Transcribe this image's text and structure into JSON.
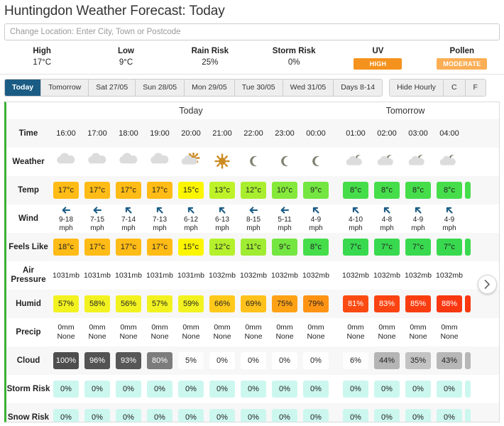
{
  "header": {
    "title": "Huntingdon Weather Forecast: Today",
    "location_placeholder": "Change Location: Enter City, Town or Postcode",
    "location_value": ""
  },
  "summary": [
    {
      "label": "High",
      "value": "17°C",
      "badge": null,
      "badge_color": null
    },
    {
      "label": "Low",
      "value": "9°C",
      "badge": null,
      "badge_color": null
    },
    {
      "label": "Rain Risk",
      "value": "25%",
      "badge": null,
      "badge_color": null
    },
    {
      "label": "Storm Risk",
      "value": "0%",
      "badge": null,
      "badge_color": null
    },
    {
      "label": "UV",
      "value": "",
      "badge": "HIGH",
      "badge_color": "#F5921E"
    },
    {
      "label": "Pollen",
      "value": "",
      "badge": "MODERATE",
      "badge_color": "#FBAE55"
    }
  ],
  "tabs": {
    "days": [
      {
        "label": "Today",
        "active": true
      },
      {
        "label": "Tomorrow",
        "active": false
      },
      {
        "label": "Sat 27/05",
        "active": false
      },
      {
        "label": "Sun 28/05",
        "active": false
      },
      {
        "label": "Mon 29/05",
        "active": false
      },
      {
        "label": "Tue 30/05",
        "active": false
      },
      {
        "label": "Wed 31/05",
        "active": false
      },
      {
        "label": "Days 8-14",
        "active": false
      }
    ],
    "options": [
      {
        "label": "Hide Hourly",
        "active": false
      },
      {
        "label": "C",
        "active": false
      },
      {
        "label": "F",
        "active": false
      }
    ],
    "active_color": "#1b5c85"
  },
  "grid": {
    "day_headings": {
      "today": "Today",
      "tomorrow": "Tomorrow"
    },
    "row_labels": {
      "time": "Time",
      "weather": "Weather",
      "temp": "Temp",
      "wind": "Wind",
      "feels_like": "Feels Like",
      "air_pressure": "Air Pressure",
      "humid": "Humid",
      "precip": "Precip",
      "cloud": "Cloud",
      "storm_risk": "Storm Risk",
      "snow_risk": "Snow Risk"
    },
    "next_button_icon": "chevron-right-icon",
    "today": {
      "times": [
        "16:00",
        "17:00",
        "18:00",
        "19:00",
        "20:00",
        "21:00",
        "22:00",
        "23:00",
        "00:00"
      ],
      "weather_icons": [
        "cloud",
        "cloud",
        "cloud",
        "cloud",
        "sun-cloud",
        "sun",
        "moon",
        "moon",
        "moon"
      ],
      "temp": [
        "17°c",
        "17°c",
        "17°c",
        "17°c",
        "15°c",
        "13°c",
        "12°c",
        "10°c",
        "9°c"
      ],
      "temp_colors": [
        "#FFBB16",
        "#FFBB16",
        "#FFBB16",
        "#FFBB16",
        "#FBF500",
        "#BDF229",
        "#A9EE2E",
        "#85E93B",
        "#74E641"
      ],
      "wind_dirs": [
        "W",
        "W",
        "SW",
        "SW",
        "SW",
        "SW",
        "W",
        "W",
        "SW"
      ],
      "wind": [
        "9-18",
        "7-15",
        "7-14",
        "7-13",
        "6-12",
        "6-13",
        "8-15",
        "5-11",
        "4-9"
      ],
      "wind_unit": "mph",
      "feels": [
        "18°c",
        "17°c",
        "17°c",
        "17°c",
        "15°c",
        "12°c",
        "11°c",
        "9°c",
        "8°c"
      ],
      "feels_colors": [
        "#FFBB16",
        "#FFBB16",
        "#FFBB16",
        "#FFBB16",
        "#FBF500",
        "#B4F02C",
        "#A0EC32",
        "#74E641",
        "#46DD4B"
      ],
      "pressure": [
        "1031mb",
        "1031mb",
        "1031mb",
        "1031mb",
        "1031mb",
        "1032mb",
        "1032mb",
        "1032mb",
        "1032mb"
      ],
      "humid": [
        "57%",
        "58%",
        "56%",
        "57%",
        "59%",
        "66%",
        "69%",
        "75%",
        "79%"
      ],
      "humid_colors": [
        "#F2F221",
        "#F2F221",
        "#F2F221",
        "#F2F221",
        "#F2F221",
        "#FFC91B",
        "#FFC11B",
        "#FFA216",
        "#FF9314"
      ],
      "humid_text_light": [
        false,
        false,
        false,
        false,
        false,
        false,
        false,
        false,
        false
      ],
      "precip_amount": [
        "0mm",
        "0mm",
        "0mm",
        "0mm",
        "0mm",
        "0mm",
        "0mm",
        "0mm",
        "0mm"
      ],
      "precip_type": [
        "None",
        "None",
        "None",
        "None",
        "None",
        "None",
        "None",
        "None",
        "None"
      ],
      "cloud": [
        "100%",
        "96%",
        "93%",
        "80%",
        "5%",
        "0%",
        "0%",
        "0%",
        "0%"
      ],
      "cloud_colors": [
        "#4d4d4d",
        "#535353",
        "#575757",
        "#7c7c7c",
        "#fdfdfd",
        "#ffffff",
        "#ffffff",
        "#ffffff",
        "#ffffff"
      ],
      "cloud_text_light": [
        true,
        true,
        true,
        true,
        false,
        false,
        false,
        false,
        false
      ],
      "storm_risk": [
        "0%",
        "0%",
        "0%",
        "0%",
        "0%",
        "0%",
        "0%",
        "0%",
        "0%"
      ],
      "snow_risk": [
        "0%",
        "0%",
        "0%",
        "0%",
        "0%",
        "0%",
        "0%",
        "0%",
        "0%"
      ],
      "risk_color": "#CCF7EF"
    },
    "tomorrow": {
      "times": [
        "01:00",
        "02:00",
        "03:00",
        "04:00"
      ],
      "weather_icons": [
        "moon-cloud",
        "moon-cloud",
        "moon-cloud",
        "moon-cloud"
      ],
      "temp": [
        "8°c",
        "8°c",
        "8°c",
        "8°c"
      ],
      "temp_colors": [
        "#46DD4B",
        "#46DD4B",
        "#46DD4B",
        "#46DD4B"
      ],
      "wind_dirs": [
        "SW",
        "SW",
        "SW",
        "SW"
      ],
      "wind": [
        "4-10",
        "4-8",
        "4-9",
        "4-9"
      ],
      "wind_unit": "mph",
      "feels": [
        "7°c",
        "7°c",
        "7°c",
        "7°c"
      ],
      "feels_colors": [
        "#39D94F",
        "#39D94F",
        "#39D94F",
        "#39D94F"
      ],
      "pressure": [
        "1032mb",
        "1032mb",
        "1032mb",
        "1032mb"
      ],
      "humid": [
        "81%",
        "83%",
        "85%",
        "88%"
      ],
      "humid_colors": [
        "#FC4B12",
        "#FC4412",
        "#FA3E11",
        "#F93711"
      ],
      "humid_text_light": [
        true,
        true,
        true,
        true
      ],
      "precip_amount": [
        "0mm",
        "0mm",
        "0mm",
        "0mm"
      ],
      "precip_type": [
        "None",
        "None",
        "None",
        "None"
      ],
      "cloud": [
        "6%",
        "44%",
        "35%",
        "43%"
      ],
      "cloud_colors": [
        "#fdfdfd",
        "#b5b5b5",
        "#c3c3c3",
        "#b7b7b7"
      ],
      "cloud_text_light": [
        false,
        false,
        false,
        false
      ],
      "storm_risk": [
        "0%",
        "0%",
        "0%",
        "0%"
      ],
      "snow_risk": [
        "0%",
        "0%",
        "0%",
        "0%"
      ],
      "risk_color": "#CCF7EF"
    },
    "edge": {
      "temp_color": "#46DD4B",
      "feels_color": "#39D94F",
      "humid_color": "#F93711",
      "cloud_color": "#b7b7b7",
      "risk_color": "#CCF7EF"
    }
  },
  "theme": {
    "accent_green": "#3cb034",
    "tab_active": "#1b5c85",
    "wind_arrow": "#1b5c85",
    "sun": "#CC8B23",
    "cloud": "#dcdcdc",
    "moon": "#7D8070"
  }
}
